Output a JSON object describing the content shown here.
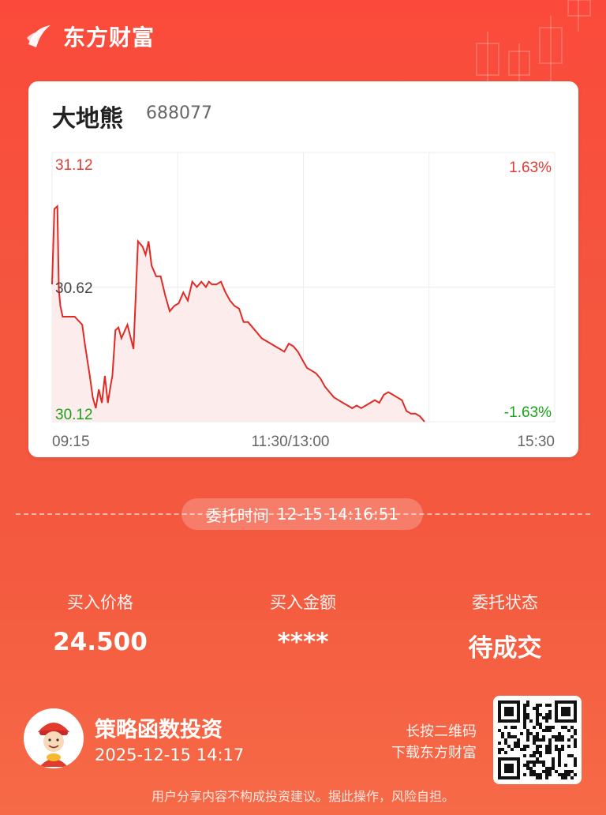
{
  "brand": {
    "name": "东方财富"
  },
  "stock": {
    "name": "大地熊",
    "code": "688077"
  },
  "chart": {
    "labels": {
      "price_high": "31.12",
      "price_mid": "30.62",
      "price_low": "30.12",
      "pct_high": "1.63%",
      "pct_low": "-1.63%",
      "time_start": "09:15",
      "time_mid": "11:30/13:00",
      "time_end": "15:30"
    },
    "colors": {
      "up": "#e03a33",
      "down": "#1aa21a",
      "line": "#e02b25",
      "fill": "#fdecec",
      "grid": "#ececec"
    }
  },
  "chart_data": {
    "type": "line",
    "title": "",
    "xlabel": "",
    "ylabel": "",
    "x_ticks": [
      "09:15",
      "11:30/13:00",
      "15:30"
    ],
    "y_ticks": [
      "31.12",
      "30.62",
      "30.12"
    ],
    "ylim": [
      30.12,
      31.12
    ],
    "ylim_pct": [
      -1.63,
      1.63
    ],
    "grid": true,
    "x": [
      0.0,
      0.0045,
      0.0105,
      0.0135,
      0.0165,
      0.021,
      0.03,
      0.045,
      0.06,
      0.066,
      0.075,
      0.081,
      0.087,
      0.093,
      0.099,
      0.105,
      0.111,
      0.117,
      0.12,
      0.126,
      0.132,
      0.138,
      0.15,
      0.162,
      0.171,
      0.18,
      0.186,
      0.192,
      0.198,
      0.207,
      0.216,
      0.225,
      0.234,
      0.243,
      0.252,
      0.261,
      0.27,
      0.279,
      0.288,
      0.297,
      0.306,
      0.312,
      0.318,
      0.327,
      0.336,
      0.345,
      0.354,
      0.363,
      0.372,
      0.381,
      0.39,
      0.399,
      0.408,
      0.417,
      0.426,
      0.435,
      0.444,
      0.453,
      0.462,
      0.471,
      0.48,
      0.489,
      0.498,
      0.507,
      0.516,
      0.525,
      0.534,
      0.543,
      0.552,
      0.561,
      0.57,
      0.579,
      0.588,
      0.597,
      0.606,
      0.615,
      0.624,
      0.633,
      0.642,
      0.651,
      0.66,
      0.669,
      0.678,
      0.687,
      0.696,
      0.705,
      0.714,
      0.723,
      0.732,
      0.741
    ],
    "y": [
      30.63,
      30.91,
      30.92,
      30.61,
      30.55,
      30.51,
      30.51,
      30.51,
      30.48,
      30.4,
      30.29,
      30.21,
      30.17,
      30.24,
      30.19,
      30.29,
      30.19,
      30.26,
      30.29,
      30.46,
      30.47,
      30.43,
      30.48,
      30.39,
      30.79,
      30.77,
      30.74,
      30.79,
      30.7,
      30.66,
      30.66,
      30.59,
      30.53,
      30.55,
      30.56,
      30.6,
      30.57,
      30.64,
      30.62,
      30.64,
      30.62,
      30.64,
      30.63,
      30.63,
      30.64,
      30.6,
      30.57,
      30.55,
      30.54,
      30.49,
      30.49,
      30.47,
      30.45,
      30.43,
      30.42,
      30.41,
      30.4,
      30.39,
      30.38,
      30.41,
      30.4,
      30.38,
      30.35,
      30.32,
      30.31,
      30.3,
      30.28,
      30.25,
      30.23,
      30.21,
      30.2,
      30.19,
      30.18,
      30.17,
      30.18,
      30.17,
      30.18,
      30.19,
      30.2,
      30.19,
      30.22,
      30.23,
      30.22,
      30.21,
      30.2,
      30.16,
      30.15,
      30.15,
      30.14,
      30.12
    ]
  },
  "order": {
    "time_label": "委托时间",
    "time_value": "12-15 14:16:51",
    "buy_price_label": "买入价格",
    "buy_price_value": "24.500",
    "buy_amount_label": "买入金额",
    "buy_amount_value": "****",
    "status_label": "委托状态",
    "status_value": "待成交"
  },
  "footer": {
    "strategy_title": "策略函数投资",
    "timestamp": "2025-12-15 14:17",
    "qr_hint_line1": "长按二维码",
    "qr_hint_line2": "下载东方财富",
    "disclaimer": "用户分享内容不构成投资建议。据此操作，风险自担。"
  },
  "icons": {
    "logo": "eastmoney-logo-icon",
    "avatar": "god-of-wealth-avatar-icon",
    "qr": "qr-code-icon"
  }
}
